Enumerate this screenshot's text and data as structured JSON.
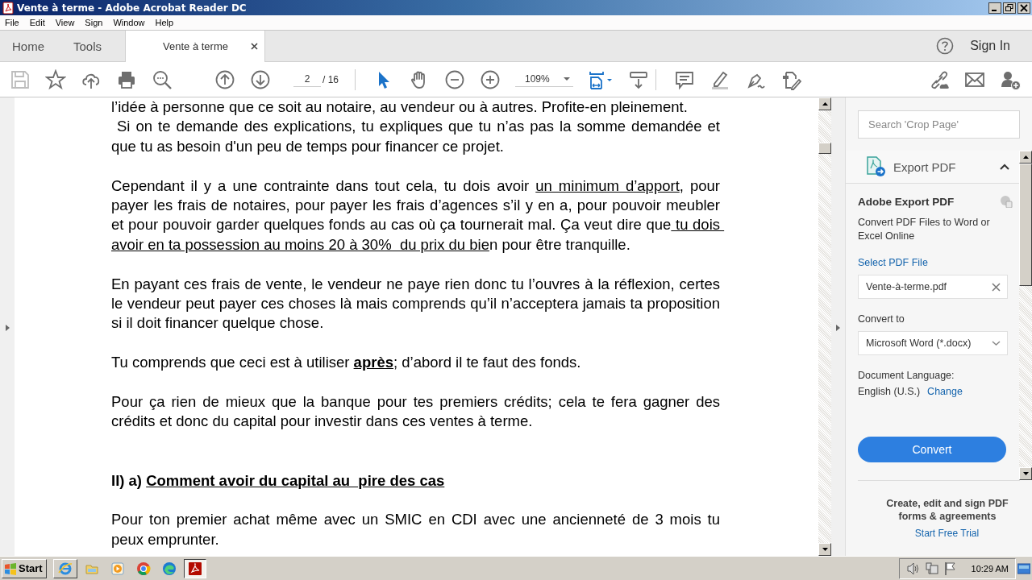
{
  "window": {
    "title": "Vente à terme - Adobe Acrobat Reader DC"
  },
  "menu": [
    "File",
    "Edit",
    "View",
    "Sign",
    "Window",
    "Help"
  ],
  "tabs": [
    {
      "label": "Home",
      "selected": false,
      "kind": "nav"
    },
    {
      "label": "Tools",
      "selected": false,
      "kind": "nav"
    },
    {
      "label": "Vente à terme",
      "selected": true,
      "kind": "document"
    }
  ],
  "sign_in": "Sign In",
  "toolbar": {
    "page_current": "2",
    "page_total": "/ 16",
    "zoom": "109%",
    "save_disabled": true
  },
  "document": {
    "paragraphs": [
      {
        "kind": "line",
        "runs": [
          {
            "text": "l’idée à personne que ce soit au notaire, au vendeur ou à autres. Profite-en pleinement."
          }
        ]
      },
      {
        "kind": "para",
        "runs": [
          {
            "text": " Si on te demande des explications, tu expliques que tu n’as pas la somme demandée et que tu as besoin d'un peu de temps pour financer ce projet."
          }
        ]
      },
      {
        "kind": "para",
        "runs": [
          {
            "text": "Cependant il y a une contrainte dans tout cela, tu dois avoir "
          },
          {
            "text": "un minimum d’apport",
            "underline": true
          },
          {
            "text": ", pour payer les frais de notaires, pour payer les frais d’agences s’il y en a, pour pouvoir meubler et pour pouvoir garder quelques fonds au cas où ça tournerait mal. Ça veut dire que"
          },
          {
            "text": " tu dois avoir en ta possession au moins 20 à 30%  du prix du bie",
            "underline": true
          },
          {
            "text": "n pour être tranquille."
          }
        ]
      },
      {
        "kind": "para",
        "runs": [
          {
            "text": "En payant ces frais de vente, le vendeur ne paye rien donc tu l’ouvres à la réflexion, certes le vendeur peut payer ces choses là mais comprends qu’il n’acceptera jamais ta proposition si il doit financer quelque chose."
          }
        ]
      },
      {
        "kind": "para",
        "runs": [
          {
            "text": "Tu comprends que ceci est à utiliser "
          },
          {
            "text": "après",
            "underline": true,
            "bold": true
          },
          {
            "text": "; d’abord il te faut des fonds."
          }
        ]
      },
      {
        "kind": "para",
        "runs": [
          {
            "text": "Pour ça rien de mieux que la banque pour tes premiers crédits; cela te fera gagner des crédits et donc du capital pour investir dans ces ventes à terme."
          }
        ]
      },
      {
        "kind": "heading",
        "runs": [
          {
            "text": "II) a) ",
            "bold": true
          },
          {
            "text": "Comment avoir du capital au  pire des cas",
            "bold": true,
            "underline": true
          }
        ]
      },
      {
        "kind": "para",
        "runs": [
          {
            "text": "Pour ton premier achat même avec un SMIC en CDI avec une ancienneté de 3 mois tu peux emprunter."
          }
        ]
      }
    ]
  },
  "panel": {
    "search_placeholder": "Search 'Crop Page'",
    "section_title": "Export PDF",
    "expanded": true,
    "heading": "Adobe Export PDF",
    "description": "Convert PDF Files to Word or Excel Online",
    "select_label": "Select PDF File",
    "file": "Vente-à-terme.pdf",
    "convert_to_label": "Convert to",
    "format": "Microsoft Word (*.docx)",
    "language_label": "Document Language:",
    "language": "English (U.S.)",
    "change_link": "Change",
    "convert_button": "Convert",
    "promo": "Create, edit and sign PDF forms & agreements",
    "trial_link": "Start Free Trial"
  },
  "taskbar": {
    "start": "Start",
    "apps": [
      {
        "kind": "ie",
        "selected": false
      },
      {
        "kind": "folder",
        "selected": false
      },
      {
        "kind": "media",
        "selected": false
      },
      {
        "kind": "chrome",
        "selected": false
      },
      {
        "kind": "edge",
        "selected": false
      },
      {
        "kind": "acrobat",
        "selected": true
      }
    ],
    "clock": "10:29 AM"
  }
}
